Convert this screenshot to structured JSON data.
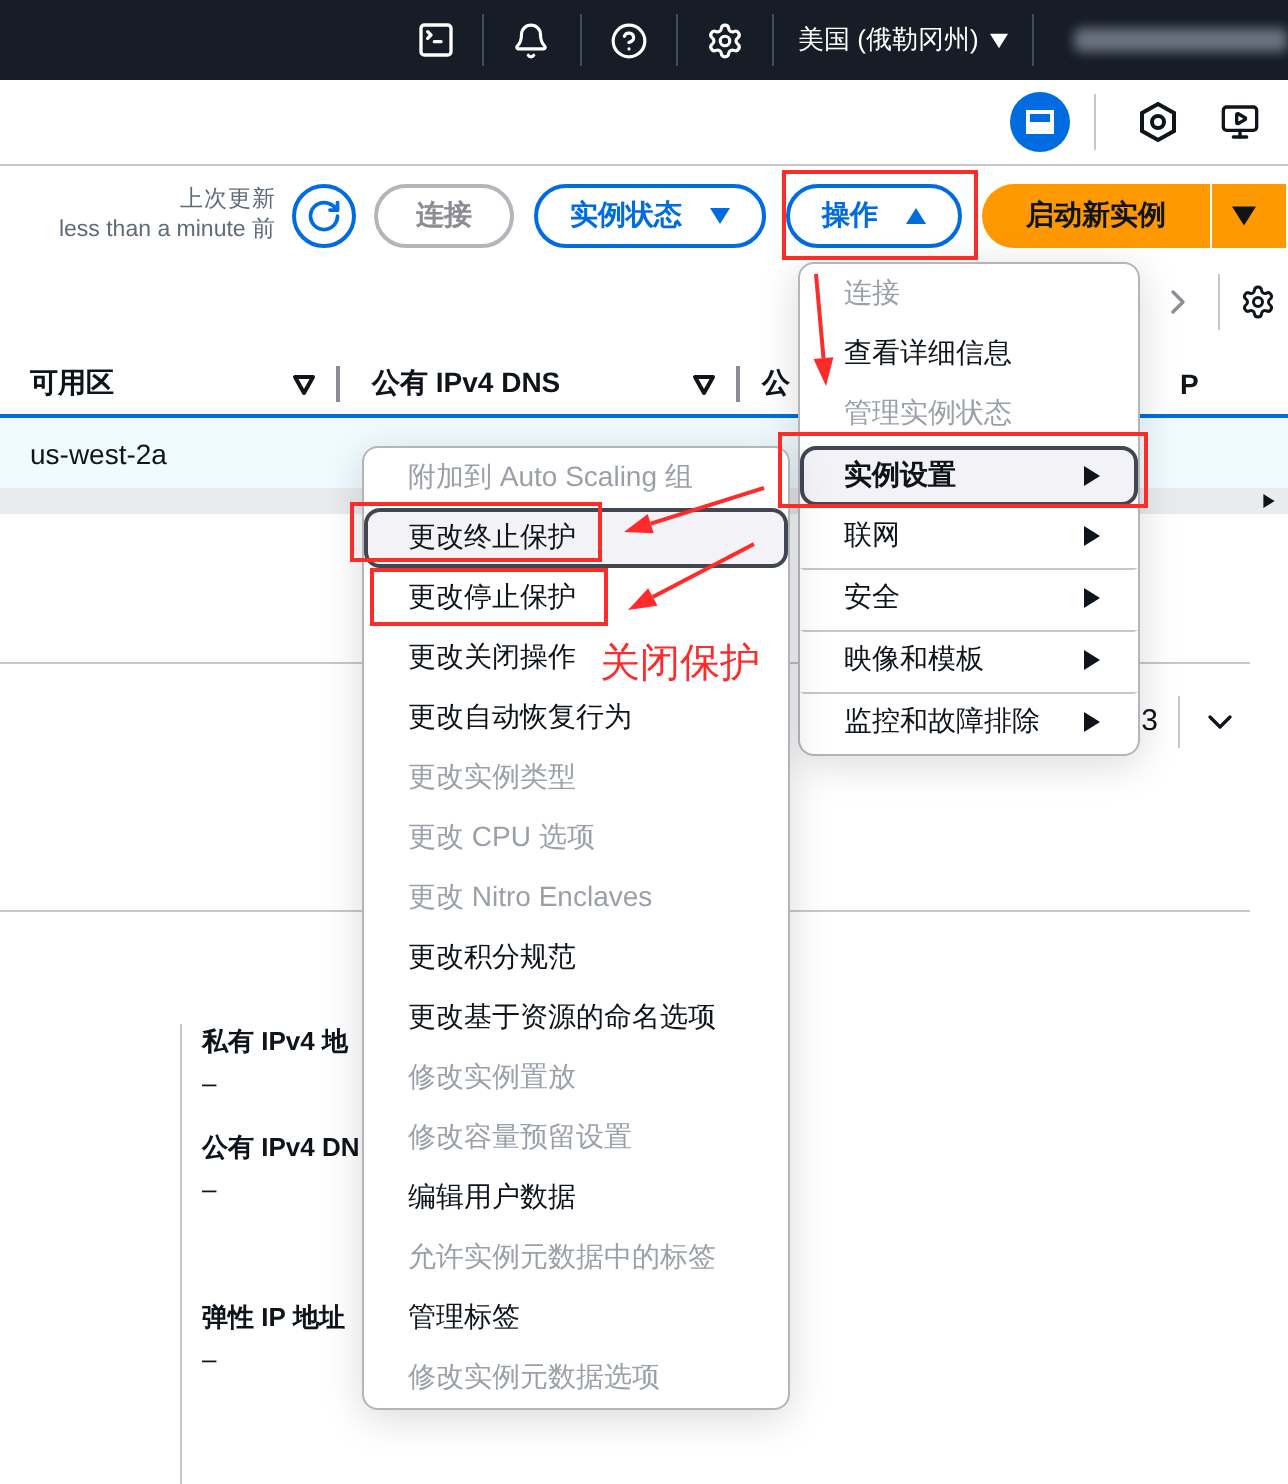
{
  "top_nav": {
    "region": "美国 (俄勒冈州)"
  },
  "toolbar": {
    "last_updated_label": "上次更新",
    "last_updated_value": "less than a minute 前",
    "buttons": [
      {
        "label": "连接",
        "kind": "plain",
        "disabled": true
      },
      {
        "label": "实例状态",
        "kind": "dropdown",
        "disabled": false,
        "expanded": false
      },
      {
        "label": "操作",
        "kind": "dropdown",
        "disabled": false,
        "expanded": true
      },
      {
        "label": "启动新实例",
        "kind": "split"
      }
    ]
  },
  "table": {
    "columns": [
      {
        "label": "可用区",
        "filter": true
      },
      {
        "label": "公有 IPv4 DNS",
        "filter": true
      },
      {
        "label": "公",
        "filter": false
      },
      {
        "label": "P",
        "filter": false
      }
    ],
    "rows": [
      {
        "cells": [
          "us-west-2a"
        ],
        "selected": true
      }
    ]
  },
  "detail_header": {
    "text": "3"
  },
  "details": [
    {
      "label": "私有 IPv4 地",
      "value": "–"
    },
    {
      "label": "公有 IPv4 DN",
      "value": "–"
    },
    {
      "label": "弹性 IP 地址",
      "value": "–"
    }
  ],
  "actions_menu": {
    "items": [
      {
        "label": "连接",
        "kind": "action",
        "disabled": true,
        "selected": false
      },
      {
        "label": "查看详细信息",
        "kind": "action",
        "disabled": false,
        "selected": false
      },
      {
        "label": "管理实例状态",
        "kind": "action",
        "disabled": true,
        "selected": false
      },
      {
        "label": "实例设置",
        "kind": "submenu",
        "disabled": false,
        "selected": true
      },
      {
        "label": "联网",
        "kind": "submenu",
        "disabled": false,
        "selected": false
      },
      {
        "label": "安全",
        "kind": "submenu",
        "disabled": false,
        "selected": false
      },
      {
        "label": "映像和模板",
        "kind": "submenu",
        "disabled": false,
        "selected": false
      },
      {
        "label": "监控和故障排除",
        "kind": "submenu",
        "disabled": false,
        "selected": false
      }
    ]
  },
  "instance_settings_menu": {
    "items": [
      {
        "label": "附加到 Auto Scaling 组",
        "disabled": true,
        "selected": false
      },
      {
        "label": "更改终止保护",
        "disabled": false,
        "selected": true
      },
      {
        "label": "更改停止保护",
        "disabled": false,
        "selected": false
      },
      {
        "label": "更改关闭操作",
        "disabled": false,
        "selected": false
      },
      {
        "label": "更改自动恢复行为",
        "disabled": false,
        "selected": false
      },
      {
        "label": "更改实例类型",
        "disabled": true,
        "selected": false
      },
      {
        "label": "更改 CPU 选项",
        "disabled": true,
        "selected": false
      },
      {
        "label": "更改 Nitro Enclaves",
        "disabled": true,
        "selected": false
      },
      {
        "label": "更改积分规范",
        "disabled": false,
        "selected": false
      },
      {
        "label": "更改基于资源的命名选项",
        "disabled": false,
        "selected": false
      },
      {
        "label": "修改实例置放",
        "disabled": true,
        "selected": false
      },
      {
        "label": "修改容量预留设置",
        "disabled": true,
        "selected": false
      },
      {
        "label": "编辑用户数据",
        "disabled": false,
        "selected": false
      },
      {
        "label": "允许实例元数据中的标签",
        "disabled": true,
        "selected": false
      },
      {
        "label": "管理标签",
        "disabled": false,
        "selected": false
      },
      {
        "label": "修改实例元数据选项",
        "disabled": true,
        "selected": false
      }
    ]
  },
  "annotation": {
    "note": "关闭保护"
  }
}
